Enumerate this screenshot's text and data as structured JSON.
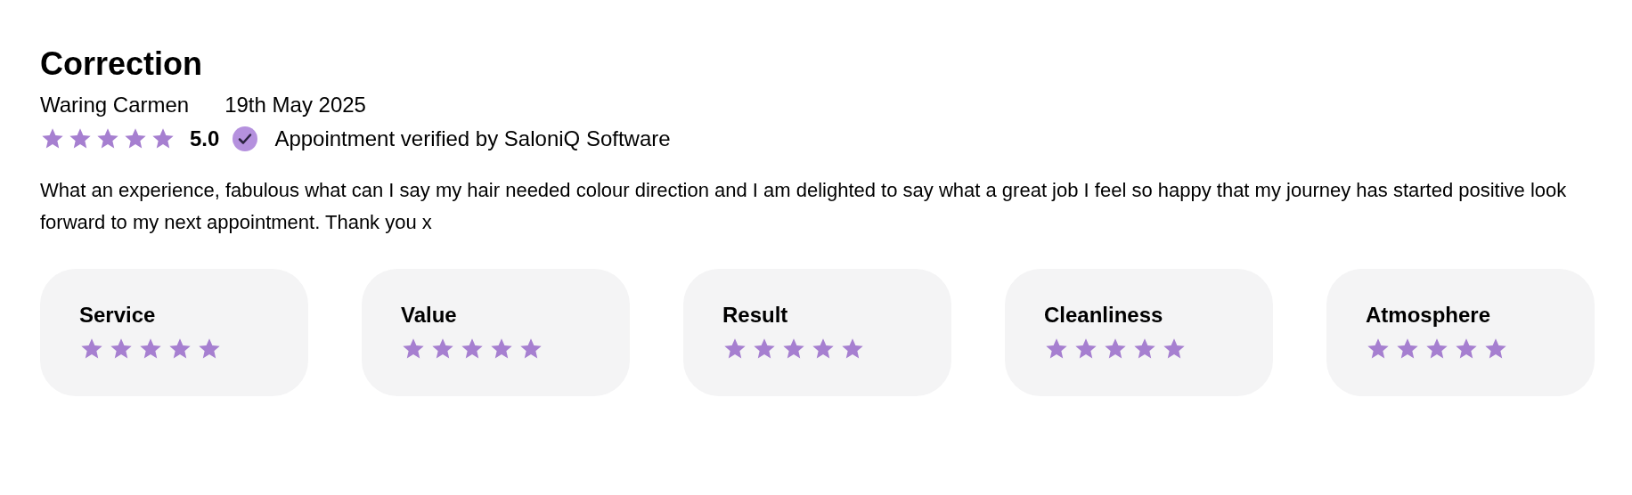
{
  "review": {
    "title": "Correction",
    "author": "Waring Carmen",
    "date": "19th May 2025",
    "stars": 5,
    "score": "5.0",
    "verified": true,
    "verified_text": "Appointment verified by SaloniQ Software",
    "body": "What an experience, fabulous what can I say my hair needed colour direction and I am delighted to say what a great job I feel so happy that my journey has started positive look forward to my next appointment. Thank you x"
  },
  "categories": [
    {
      "label": "Service",
      "stars": 5
    },
    {
      "label": "Value",
      "stars": 5
    },
    {
      "label": "Result",
      "stars": 5
    },
    {
      "label": "Cleanliness",
      "stars": 5
    },
    {
      "label": "Atmosphere",
      "stars": 5
    }
  ]
}
